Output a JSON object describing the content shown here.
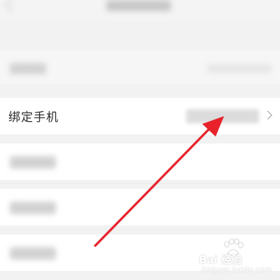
{
  "bind_phone": {
    "label": "绑定手机"
  },
  "arrow_color": "#e8202a",
  "icons": [
    "back-icon",
    "chevron-right-icon",
    "baidu-paw-icon"
  ],
  "watermark": {
    "brand": "Bai 经验",
    "sub": "jingyan.baidu.com"
  }
}
